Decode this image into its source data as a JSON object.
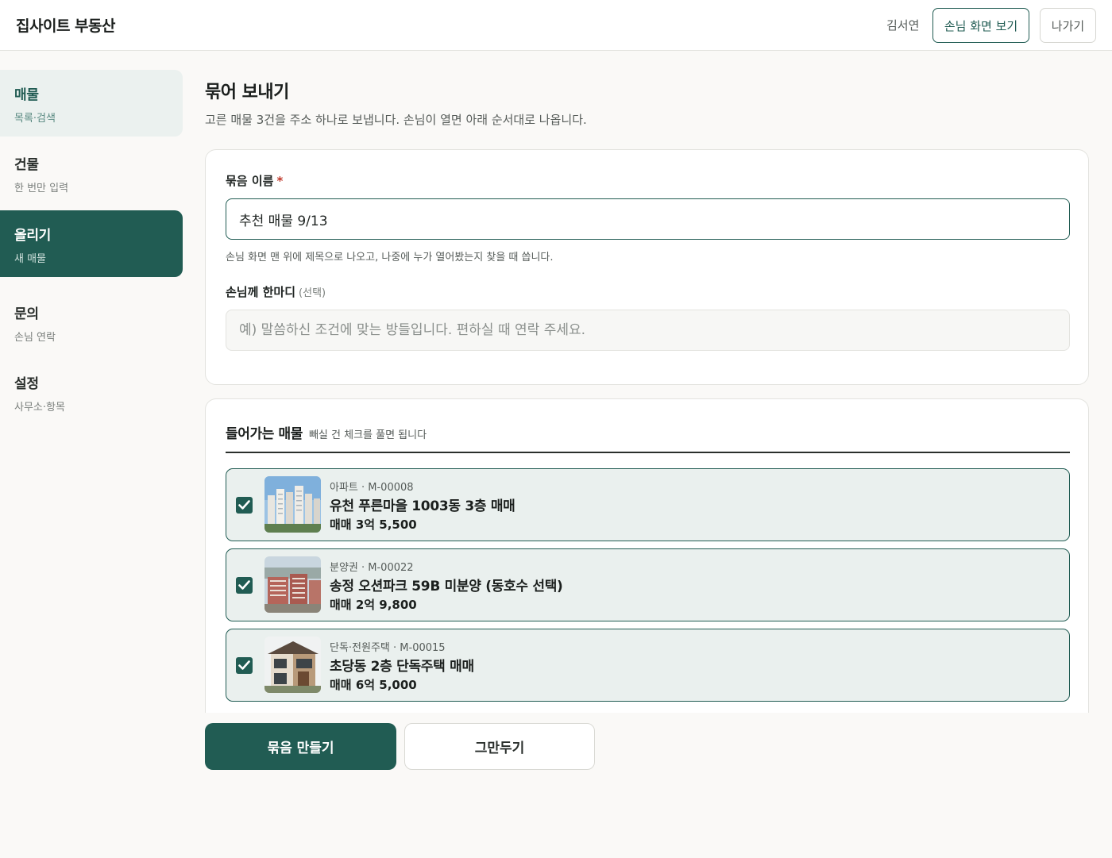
{
  "header": {
    "brand": "집사이트 부동산",
    "user_name": "김서연",
    "preview_label": "손님 화면 보기",
    "logout_label": "나가기"
  },
  "sidebar": {
    "items": [
      {
        "title": "매물",
        "sub": "목록·검색",
        "state": "soft"
      },
      {
        "title": "건물",
        "sub": "한 번만 입력",
        "state": "plain"
      },
      {
        "title": "올리기",
        "sub": "새 매물",
        "state": "active"
      },
      {
        "title": "문의",
        "sub": "손님 연락",
        "state": "plain"
      },
      {
        "title": "설정",
        "sub": "사무소·항목",
        "state": "plain"
      }
    ]
  },
  "main": {
    "title": "묶어 보내기",
    "description": "고른 매물 3건을 주소 하나로 보냅니다. 손님이 열면 아래 순서대로 나옵니다.",
    "bundle_name": {
      "label": "묶음 이름",
      "required_mark": "*",
      "value": "추천 매물 9/13",
      "hint": "손님 화면 맨 위에 제목으로 나오고, 나중에 누가 열어봤는지 찾을 때 씁니다."
    },
    "message": {
      "label": "손님께 한마디",
      "optional": "(선택)",
      "placeholder": "예) 말씀하신 조건에 맞는 방들입니다. 편하실 때 연락 주세요."
    },
    "included": {
      "title": "들어가는 매물",
      "hint": "빼실 건 체크를 풀면 됩니다",
      "items": [
        {
          "meta": "아파트 · M-00008",
          "name": "유천 푸른마을 1003동 3층 매매",
          "price": "매매 3억 5,500",
          "checked": true
        },
        {
          "meta": "분양권 · M-00022",
          "name": "송정 오션파크 59B 미분양 (동호수 선택)",
          "price": "매매 2억 9,800",
          "checked": true
        },
        {
          "meta": "단독·전원주택 · M-00015",
          "name": "초당동 2층 단독주택 매매",
          "price": "매매 6억 5,000",
          "checked": true
        }
      ]
    },
    "actions": {
      "create_label": "묶음 만들기",
      "cancel_label": "그만두기"
    }
  },
  "colors": {
    "accent": "#215c53",
    "accent_soft": "#eaf0ee",
    "background": "#faf9f7"
  }
}
